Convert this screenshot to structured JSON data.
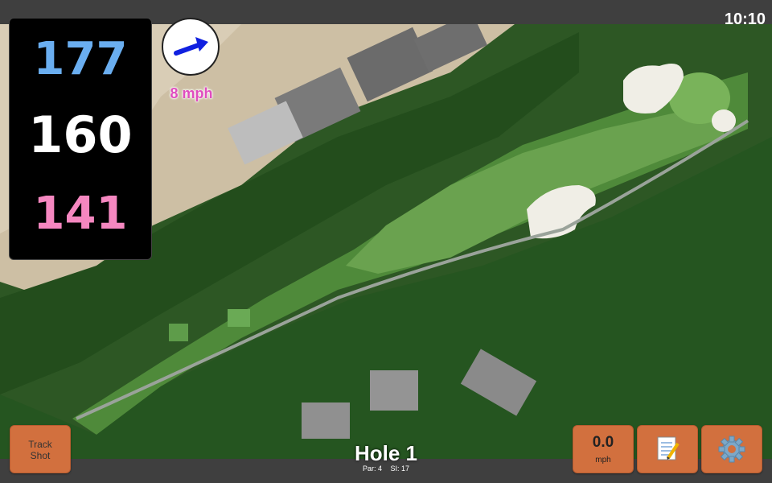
{
  "status": {
    "time": "10:10"
  },
  "distances": {
    "back": "177",
    "center": "160",
    "front": "141"
  },
  "wind": {
    "speed": "8 mph",
    "icon": "wind-arrow-icon"
  },
  "buttons": {
    "track_shot": [
      "Track",
      "Shot"
    ],
    "speed_value": "0.0",
    "speed_unit": "mph",
    "notes_icon": "notepad-icon",
    "settings_icon": "gear-icon"
  },
  "hole": {
    "title": "Hole 1",
    "par": "Par: 4",
    "si": "SI: 17"
  },
  "colors": {
    "back": "#6aaef0",
    "center": "#ffffff",
    "front": "#f587c0",
    "wind": "#e04dbf",
    "button": "#d2703e"
  }
}
